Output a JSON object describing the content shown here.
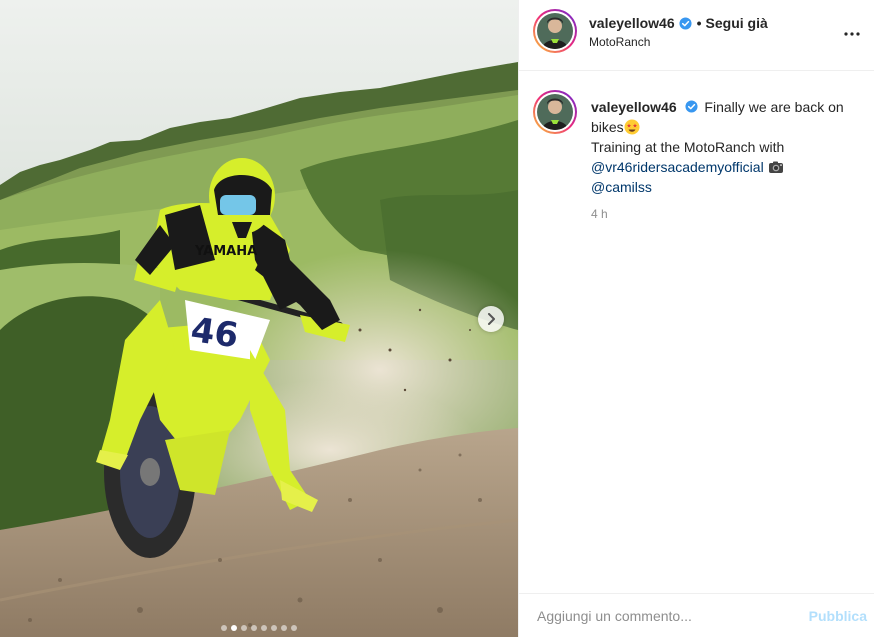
{
  "post": {
    "images_count": 8,
    "active_image_index": 1
  },
  "header": {
    "username": "valeyellow46",
    "separator": "•",
    "follow_label": "Segui già",
    "location": "MotoRanch",
    "more_icon": "more-horizontal-icon"
  },
  "caption": {
    "username": "valeyellow46",
    "text_line1": "Finally we are back on bikes",
    "text_line2": "Training at the MotoRanch with",
    "mention1": "@vr46ridersacademyofficial",
    "mention2": "@camilss",
    "emoji1": "star-struck-emoji",
    "emoji2": "camera-emoji"
  },
  "timestamp": "4 h",
  "comment": {
    "placeholder": "Aggiungi un commento...",
    "publish_label": "Pubblica"
  },
  "colors": {
    "accent_blue": "#0095f6",
    "publish_disabled": "#b2dffc",
    "verified": "#3897f0",
    "rider_yellow": "#d6ee2b"
  }
}
